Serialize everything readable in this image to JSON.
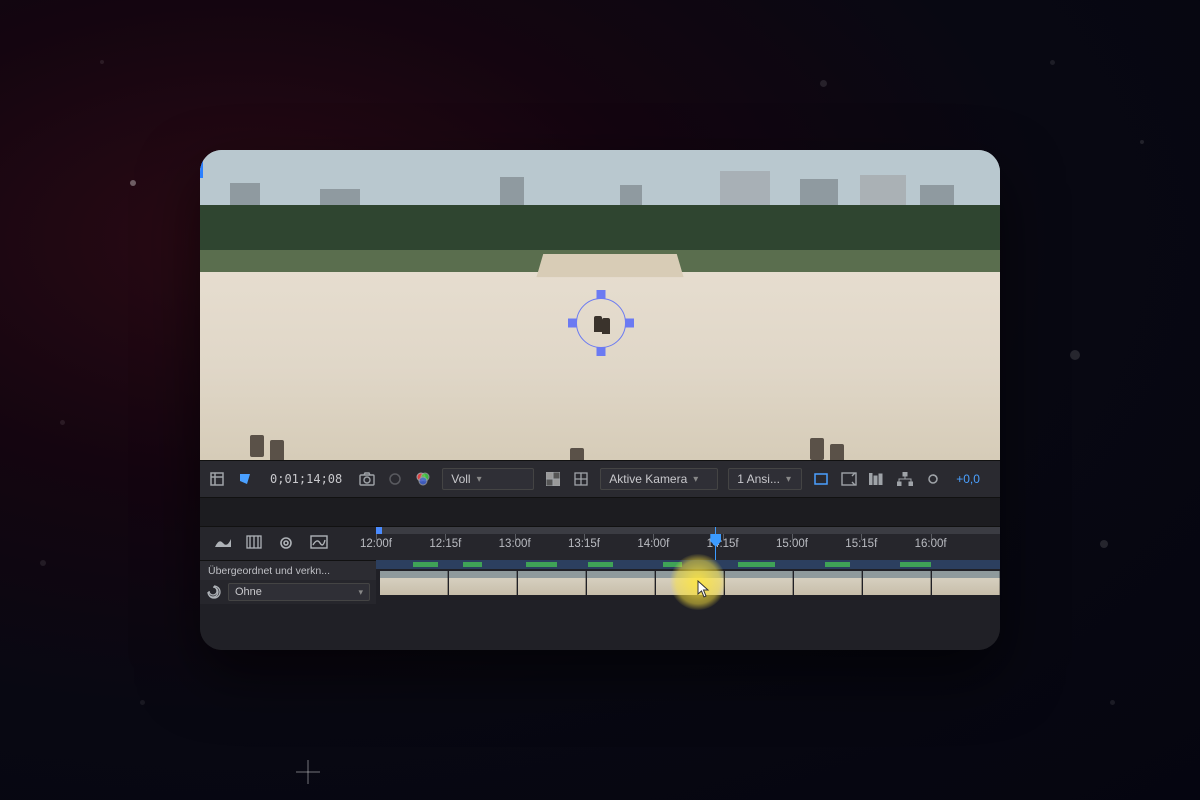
{
  "viewer": {
    "timecode": "0;01;14;08",
    "resolution_label": "Voll",
    "camera_label": "Aktive Kamera",
    "views_label": "1 Ansi...",
    "exposure_value": "+0,0"
  },
  "timeline": {
    "ticks": [
      "12:00f",
      "12:15f",
      "13:00f",
      "13:15f",
      "14:00f",
      "14:15f",
      "15:00f",
      "15:15f",
      "16:00f"
    ],
    "playhead_tick_index": 4.35,
    "column_label": "Übergeordnet und verkn...",
    "parent_dropdown_label": "Ohne"
  },
  "colors": {
    "accent_blue": "#3c9bff",
    "tracker_blue": "#6b7af2",
    "highlight_yellow": "#ffe63c"
  }
}
